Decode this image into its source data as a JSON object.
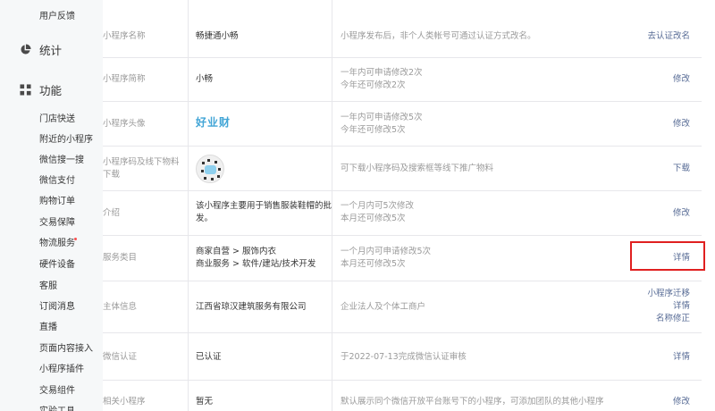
{
  "sidebar": {
    "top_item": "用户反馈",
    "groups": [
      {
        "label": "统计",
        "icon": "pie-chart-icon"
      },
      {
        "label": "功能",
        "icon": "grid-icon"
      }
    ],
    "items": [
      "门店快送",
      "附近的小程序",
      "微信搜一搜",
      "微信支付",
      "购物订单",
      "交易保障",
      "物流服务",
      "硬件设备",
      "客服",
      "订阅消息",
      "直播",
      "页面内容接入",
      "小程序插件",
      "交易组件",
      "实验工具"
    ]
  },
  "rows": [
    {
      "label": "小程序名称",
      "value": [
        "畅捷通小畅"
      ],
      "desc": [
        "小程序发布后，非个人类帐号可通过认证方式改名。"
      ],
      "actions": [
        "去认证改名"
      ]
    },
    {
      "label": "小程序简称",
      "value": [
        "小畅"
      ],
      "desc": [
        "一年内可申请修改2次",
        "今年还可修改2次"
      ],
      "actions": [
        "修改"
      ]
    },
    {
      "label": "小程序头像",
      "value": [],
      "desc": [
        "一年内可申请修改5次",
        "今年还可修改5次"
      ],
      "actions": [
        "修改"
      ],
      "avatar_text": "好业财"
    },
    {
      "label": "小程序码及线下物料下载",
      "value": [],
      "desc": [
        "可下载小程序码及搜索框等线下推广物料"
      ],
      "actions": [
        "下载"
      ]
    },
    {
      "label": "介绍",
      "value": [
        "该小程序主要用于销售服装鞋帽的批发。"
      ],
      "desc": [
        "一个月内可5次修改",
        "本月还可修改5次"
      ],
      "actions": [
        "修改"
      ]
    },
    {
      "label": "服务类目",
      "value": [
        "商家自营 > 服饰内衣",
        "商业服务 > 软件/建站/技术开发"
      ],
      "desc": [
        "一个月内可申请修改5次",
        "本月还可修改5次"
      ],
      "actions": [
        "详情"
      ]
    },
    {
      "label": "主体信息",
      "value": [
        "江西省琼汉建筑服务有限公司"
      ],
      "desc": [
        "企业法人及个体工商户"
      ],
      "actions": [
        "小程序迁移",
        "详情",
        "名称修正"
      ]
    },
    {
      "label": "微信认证",
      "value": [
        "已认证"
      ],
      "desc": [
        "于2022-07-13完成微信认证审核"
      ],
      "actions": [
        "详情"
      ]
    },
    {
      "label": "相关小程序",
      "value": [
        "暂无"
      ],
      "desc": [
        "默认展示同个微信开放平台账号下的小程序，可添加团队的其他小程序"
      ],
      "actions": [
        "修改"
      ]
    }
  ],
  "colors": {
    "link": "#576b95",
    "muted": "#9a9a9a",
    "text": "#353535",
    "highlight": "#e02020",
    "sidebar_bg": "#f6f8f9"
  }
}
